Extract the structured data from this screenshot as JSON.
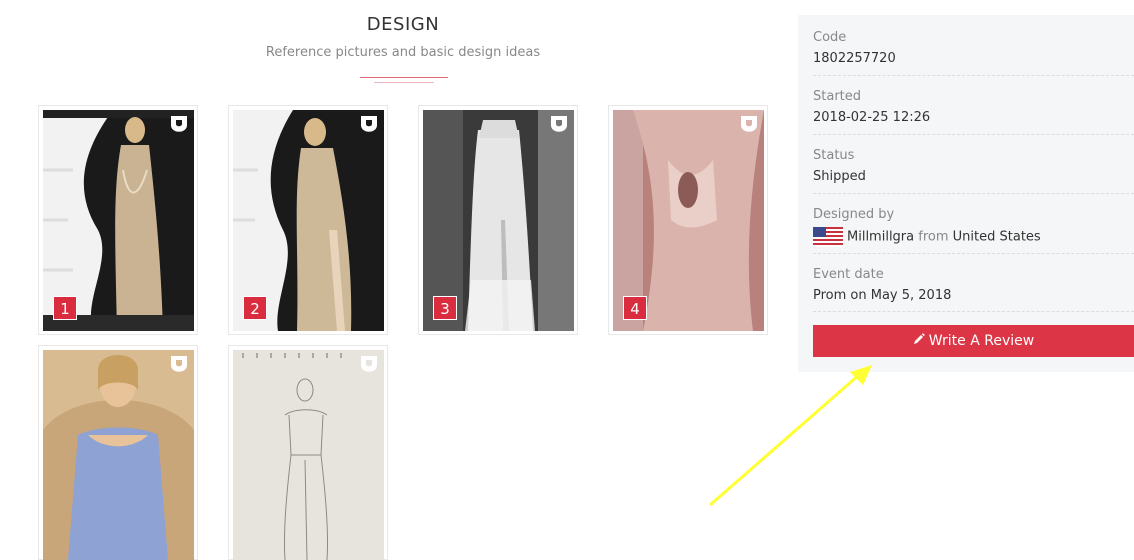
{
  "design": {
    "title": "DESIGN",
    "subtitle": "Reference pictures and basic design ideas"
  },
  "gallery": {
    "items": [
      {
        "badge": "1",
        "icon": "brand-u-icon"
      },
      {
        "badge": "2",
        "icon": "brand-u-icon"
      },
      {
        "badge": "3",
        "icon": "brand-u-icon"
      },
      {
        "badge": "4",
        "icon": "brand-u-icon"
      },
      {
        "badge": "",
        "icon": "brand-u-icon"
      },
      {
        "badge": "",
        "icon": "brand-u-icon"
      }
    ]
  },
  "order": {
    "code_label": "Code",
    "code_value": "1802257720",
    "started_label": "Started",
    "started_value": "2018-02-25 12:26",
    "status_label": "Status",
    "status_value": "Shipped",
    "designed_by_label": "Designed by",
    "designer_name": "Millmillgra",
    "from_word": "from",
    "country": "United States",
    "event_date_label": "Event date",
    "event_date_value": "Prom on May 5, 2018",
    "review_button": "Write A Review"
  },
  "colors": {
    "accent": "#dc3545",
    "panel_bg": "#f5f6f7",
    "annotation_arrow": "#ffff33"
  }
}
